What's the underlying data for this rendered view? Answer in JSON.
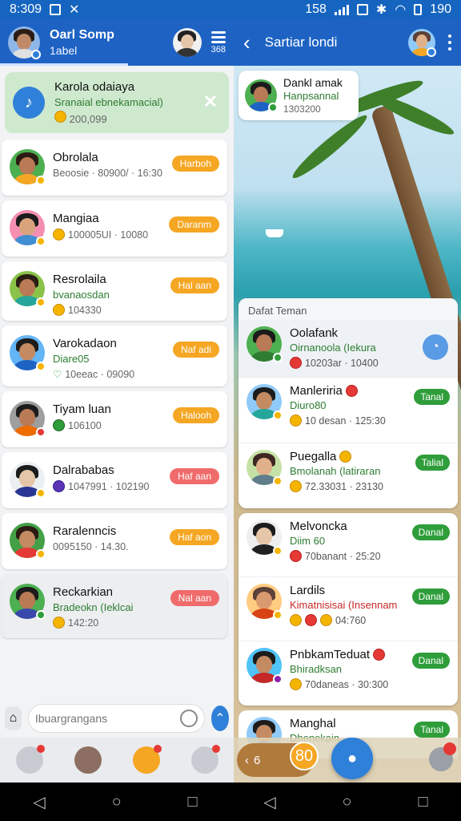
{
  "status_bar": {
    "time": "8:309",
    "right_time_left": "158",
    "right_time": "190"
  },
  "left_header": {
    "title": "Oarl Somp",
    "subtitle": "1abel",
    "menu_count": "368"
  },
  "highlight": {
    "name": "Karola odaiaya",
    "sub": "Sranaial ebnekamacial)",
    "meta": "200,099"
  },
  "chats": [
    {
      "name": "Obrolala",
      "sub": "",
      "meta": "Beoosie · 80900/ · 16:30",
      "pill": "Harboh",
      "pill_red": false
    },
    {
      "name": "Mangiaa",
      "sub": "",
      "meta": "100005UI · 10080",
      "pill": "Daranm",
      "pill_red": false
    },
    {
      "name": "Resrolaila",
      "sub": "bvanaosdan",
      "meta": "104330",
      "pill": "Hal aan",
      "pill_red": false
    },
    {
      "name": "Varokadaon",
      "sub": "Diare05",
      "meta": "10eeac · 09090",
      "pill": "Naf adi",
      "pill_red": false
    },
    {
      "name": "Tiyam luan",
      "sub": "",
      "meta": "106100",
      "pill": "Halooh",
      "pill_red": false
    },
    {
      "name": "Dalrababas",
      "sub": "",
      "meta": "1047991 · 102190",
      "pill": "Haf aan",
      "pill_red": true
    },
    {
      "name": "Raralenncis",
      "sub": "",
      "meta": "0095150 · 14.30.",
      "pill": "Haf aon",
      "pill_red": false
    },
    {
      "name": "Reckarkian",
      "sub": "Bradeokn (Ieklcai",
      "meta": "142:20",
      "pill": "Nal aan",
      "pill_red": true
    }
  ],
  "composer": {
    "placeholder": "Ibuargrangans"
  },
  "right_header": {
    "title": "Sartiar londi"
  },
  "pinned": {
    "name": "Dankl amak",
    "sub": "Hanpsannal",
    "meta": "1303200"
  },
  "friends_title": "Dafat Teman",
  "friends": [
    {
      "name": "Oolafank",
      "sub": "Oirnanoola (Iekura",
      "meta": "10203ar · 10400",
      "pill": ""
    },
    {
      "name": "Manleriria",
      "sub": "Diuro80",
      "meta": "10 desan · 125:30",
      "pill": "Tanal"
    },
    {
      "name": "Puegalla",
      "sub": "Bmolanah (latiraran",
      "meta": "72.33031 · 23130",
      "pill": "Talial"
    }
  ],
  "friends2": [
    {
      "name": "Melvoncka",
      "sub": "Diim 60",
      "sub_red": false,
      "meta": "70banant · 25:20",
      "pill": "Danal"
    },
    {
      "name": "Lardils",
      "sub": "Kimatnisisai (Insennam",
      "sub_red": true,
      "meta": "04:760",
      "pill": "Danal"
    },
    {
      "name": "PnbkamTeduat",
      "sub": "Bhiradksan",
      "sub_red": false,
      "meta": "70daneas · 30:300",
      "pill": "Danal"
    }
  ],
  "friends3": {
    "name": "Manghal",
    "sub": "Dhenekain",
    "pill": "Tanal"
  },
  "right_bottom": {
    "count": "80",
    "back_text": "6"
  },
  "colors": {
    "primary": "#1e63c4",
    "accent": "#f5a623",
    "online": "#2e9d3a",
    "danger": "#e53935"
  }
}
